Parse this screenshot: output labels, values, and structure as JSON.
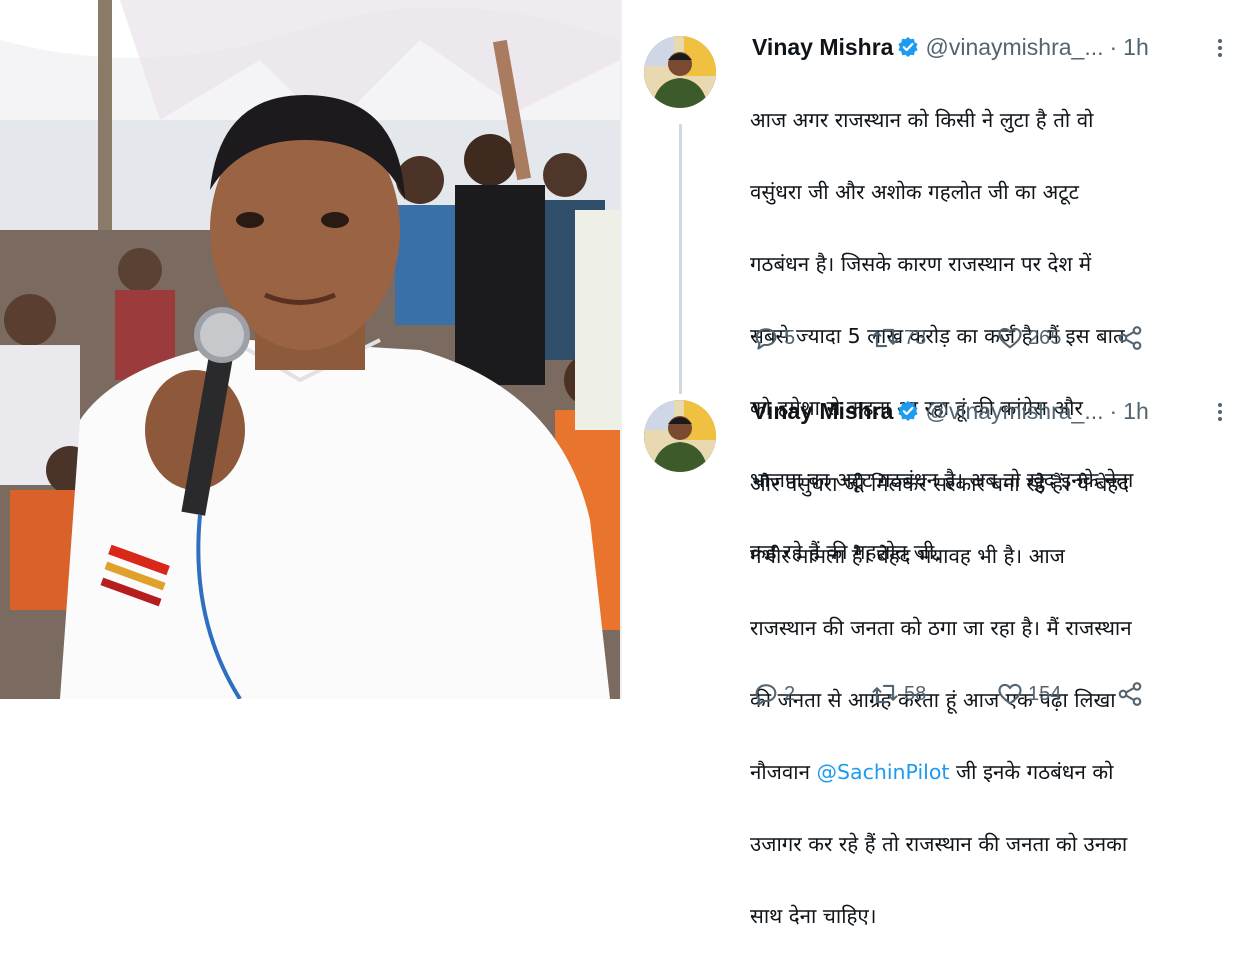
{
  "photo": {
    "description_icon": "speaker-photo"
  },
  "tweets": [
    {
      "name": "Vinay Mishra",
      "handle": "@vinaymishra_...",
      "separator": "·",
      "time": "1h",
      "body_lines": [
        "आज अगर राजस्थान को किसी ने लुटा है तो वो",
        "वसुंधरा जी और अशोक गहलोत जी का अटूट",
        "गठबंधन है। जिसके कारण राजस्थान पर देश में",
        "सबसे ज्यादा 5 लाख करोड़ का कर्ज है। मैं इस बात",
        "को हमेशा से कहता आ रहा हूं की कांग्रेस और",
        "भाजपा का अटूट गठबंधन है। अब तो खुद इनके नेता",
        "कह रहे हैं की गहलोत जी,"
      ],
      "replies": "5",
      "retweets": "73",
      "likes": "265"
    },
    {
      "name": "Vinay Mishra",
      "handle": "@vinaymishra_...",
      "separator": "·",
      "time": "1h",
      "body_lines": [
        "और वसुंधरा जी मिलकर सरकार बना रहे हैं। ये बेहद",
        "गंभीर मामला है। बेहद भयावह भी है। आज",
        "राजस्थान की जनता को ठगा जा रहा है। मैं राजस्थान",
        "की जनता से आग्रह करता हूं आज एक पढ़ा लिखा"
      ],
      "mention_prefix": "नौजवान ",
      "mention": "@SachinPilot",
      "mention_suffix": " जी इनके गठबंधन को",
      "body_lines_after": [
        "उजागर कर रहे हैं तो राजस्थान की जनता को उनका",
        "साथ देना चाहिए।"
      ],
      "replies": "2",
      "retweets": "58",
      "likes": "154"
    }
  ],
  "colors": {
    "text": "#0f1419",
    "secondary": "#536471",
    "accent": "#1d9bf0",
    "thread": "#cfd9de"
  },
  "icons": [
    "verified-badge-icon",
    "more-options-icon",
    "reply-icon",
    "retweet-icon",
    "like-icon",
    "share-icon"
  ]
}
